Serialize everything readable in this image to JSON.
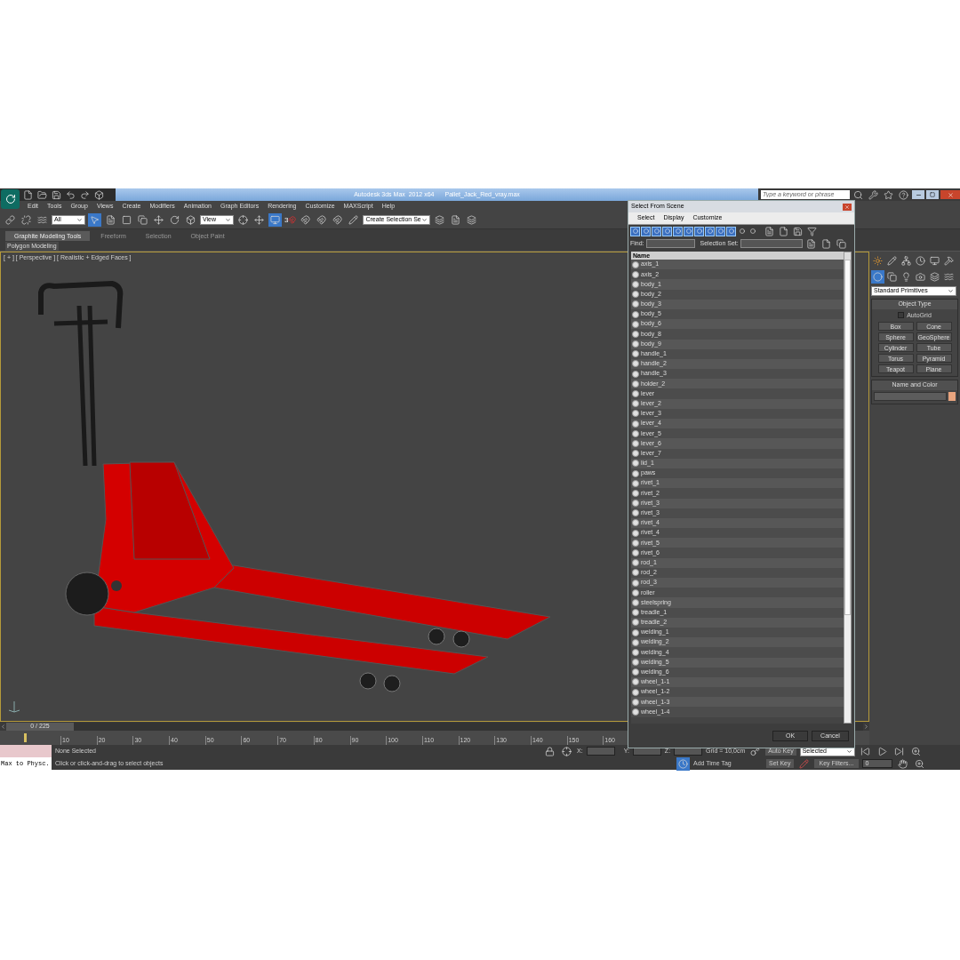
{
  "window": {
    "app_title": "Autodesk 3ds Max  2012 x64",
    "file_name": "Pallet_Jack_Red_vray.max"
  },
  "search": {
    "placeholder": "Type a keyword or phrase"
  },
  "menu": [
    "Edit",
    "Tools",
    "Group",
    "Views",
    "Create",
    "Modifiers",
    "Animation",
    "Graph Editors",
    "Rendering",
    "Customize",
    "MAXScript",
    "Help"
  ],
  "toolbar": {
    "filter": "All",
    "coordinate_system": "View",
    "snap_label": "3",
    "selection_set": "Create Selection Se"
  },
  "ribbon": {
    "tabs": [
      {
        "label": "Graphite Modeling Tools",
        "selected": true
      },
      {
        "label": "Freeform",
        "selected": false
      },
      {
        "label": "Selection",
        "selected": false
      },
      {
        "label": "Object Paint",
        "selected": false
      }
    ],
    "panel": "Polygon Modeling"
  },
  "viewport": {
    "label": "[ + ] [ Perspective ] [ Realistic + Edged Faces ]"
  },
  "command_panel": {
    "category": "Standard Primitives",
    "object_type": {
      "title": "Object Type",
      "autogrid": {
        "label": "AutoGrid",
        "checked": false
      },
      "buttons": [
        "Box",
        "Cone",
        "Sphere",
        "GeoSphere",
        "Cylinder",
        "Tube",
        "Torus",
        "Pyramid",
        "Teapot",
        "Plane"
      ]
    },
    "name_and_color": {
      "title": "Name and Color",
      "color": "#e8a47e"
    }
  },
  "timeline": {
    "position": "0 / 225",
    "level": 0,
    "ticks": [
      "10",
      "20",
      "30",
      "40",
      "50",
      "60",
      "70",
      "80",
      "90",
      "100",
      "110",
      "120",
      "130",
      "140",
      "150",
      "160"
    ]
  },
  "status": {
    "listener": "Max to Physc.",
    "selection": "None Selected",
    "prompt": "Click or click-and-drag to select objects",
    "x_label": "X:",
    "y_label": "Y:",
    "z_label": "Z:",
    "grid": "Grid = 10,0cm",
    "add_time_tag": "Add Time Tag",
    "auto_key": "Auto Key",
    "key_mode": "Selected",
    "set_key": "Set Key",
    "key_filters": "Key Filters...",
    "frame": "0"
  },
  "dialog": {
    "title": "Select From Scene",
    "menu": [
      "Select",
      "Display",
      "Customize"
    ],
    "filters": [
      {
        "on": true
      },
      {
        "on": true
      },
      {
        "on": true
      },
      {
        "on": true
      },
      {
        "on": true
      },
      {
        "on": true
      },
      {
        "on": true
      },
      {
        "on": true
      },
      {
        "on": true
      },
      {
        "on": true
      },
      {
        "on": false
      },
      {
        "on": false
      }
    ],
    "find_label": "Find:",
    "selection_set_label": "Selection Set:",
    "column": "Name",
    "items": [
      "axis_1",
      "axis_2",
      "body_1",
      "body_2",
      "body_3",
      "body_5",
      "body_6",
      "body_8",
      "body_9",
      "handle_1",
      "handle_2",
      "handle_3",
      "holder_2",
      "lever",
      "lever_2",
      "lever_3",
      "lever_4",
      "lever_5",
      "lever_6",
      "lever_7",
      "lid_1",
      "paws",
      "rivet_1",
      "rivet_2",
      "rivet_3",
      "rivet_3",
      "rivet_4",
      "rivet_4",
      "rivet_5",
      "rivet_6",
      "rod_1",
      "rod_2",
      "rod_3",
      "roller",
      "steelspring",
      "treadle_1",
      "treadle_2",
      "welding_1",
      "welding_2",
      "welding_4",
      "welding_5",
      "welding_6",
      "wheel_1-1",
      "wheel_1-2",
      "wheel_1-3",
      "wheel_1-4"
    ],
    "ok": "OK",
    "cancel": "Cancel"
  }
}
